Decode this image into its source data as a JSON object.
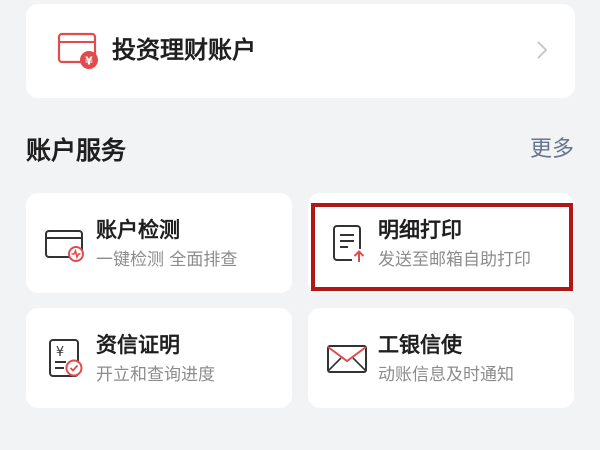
{
  "invest_account": {
    "label": "投资理财账户",
    "icon": "wallet-coin-icon",
    "accent": "#e04b4b"
  },
  "account_services": {
    "title": "账户服务",
    "more_label": "更多",
    "items": [
      {
        "title": "账户检测",
        "subtitle": "一键检测 全面排查",
        "icon": "account-check-icon"
      },
      {
        "title": "明细打印",
        "subtitle": "发送至邮箱自助打印",
        "icon": "statement-print-icon"
      },
      {
        "title": "资信证明",
        "subtitle": "开立和查询进度",
        "icon": "credit-certificate-icon"
      },
      {
        "title": "工银信使",
        "subtitle": "动账信息及时通知",
        "icon": "envelope-icon"
      }
    ]
  },
  "colors": {
    "page_bg": "#f2f3f5",
    "card_bg": "#ffffff",
    "icon_red": "#e04b4b",
    "more_link": "#66768f",
    "highlight_border": "#b01818"
  }
}
